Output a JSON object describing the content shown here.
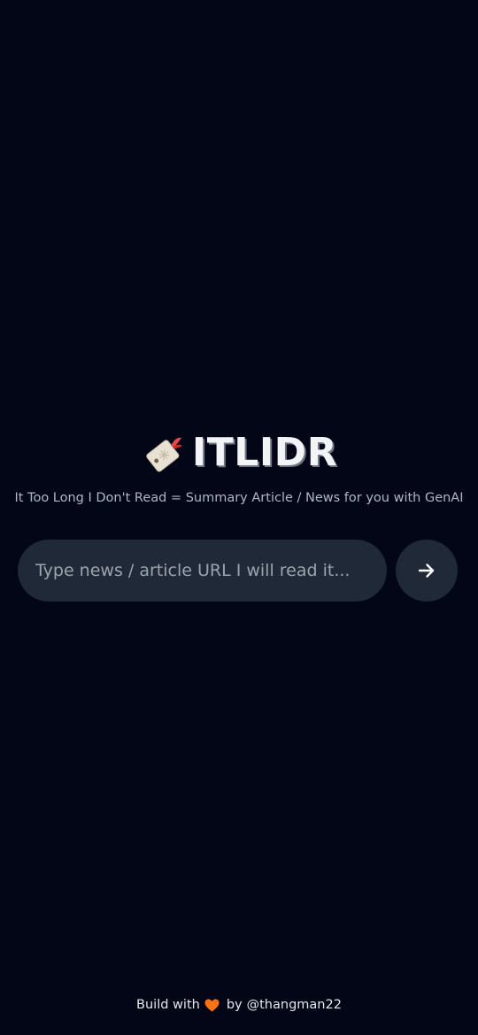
{
  "header": {
    "logo_icon": "label-tag-icon",
    "title": "ITLIDR",
    "subtitle": "It Too Long I Don't Read = Summary Article / News for you with GenAI"
  },
  "search": {
    "placeholder": "Type news / article URL I will read it...",
    "value": "",
    "submit_icon": "arrow-right-icon"
  },
  "footer": {
    "prefix": "Build with",
    "heart_icon": "orange-heart-icon",
    "by": "by",
    "author": "@thangman22"
  },
  "colors": {
    "background": "#030617",
    "input_background": "#1f2937",
    "heart": "#f97316"
  }
}
